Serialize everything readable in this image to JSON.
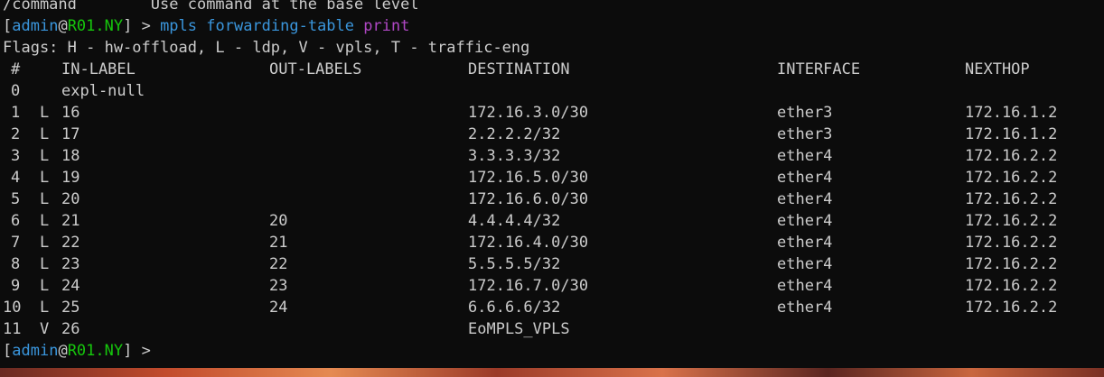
{
  "terminal": {
    "line0": {
      "cmd": "/command",
      "desc": "Use command at the base level"
    },
    "prompt1": {
      "open_bracket": "[",
      "user": "admin",
      "at": "@",
      "host": "R01.NY",
      "close": "] > ",
      "cmd1": "mpls",
      "cmd2": " forwarding-table",
      "cmd3": " print"
    },
    "flags_line": "Flags: H - hw-offload, L - ldp, V - vpls, T - traffic-eng",
    "headers": {
      "num": "#",
      "in_label": "IN-LABEL",
      "out_labels": "OUT-LABELS",
      "destination": "DESTINATION",
      "interface": "INTERFACE",
      "nexthop": "NEXTHOP"
    },
    "rows": [
      {
        "num": "0",
        "flag": "",
        "in": "expl-null",
        "out": "",
        "dst": "",
        "iface": "",
        "nh": ""
      },
      {
        "num": "1",
        "flag": "L",
        "in": "16",
        "out": "",
        "dst": "172.16.3.0/30",
        "iface": "ether3",
        "nh": "172.16.1.2"
      },
      {
        "num": "2",
        "flag": "L",
        "in": "17",
        "out": "",
        "dst": "2.2.2.2/32",
        "iface": "ether3",
        "nh": "172.16.1.2"
      },
      {
        "num": "3",
        "flag": "L",
        "in": "18",
        "out": "",
        "dst": "3.3.3.3/32",
        "iface": "ether4",
        "nh": "172.16.2.2"
      },
      {
        "num": "4",
        "flag": "L",
        "in": "19",
        "out": "",
        "dst": "172.16.5.0/30",
        "iface": "ether4",
        "nh": "172.16.2.2"
      },
      {
        "num": "5",
        "flag": "L",
        "in": "20",
        "out": "",
        "dst": "172.16.6.0/30",
        "iface": "ether4",
        "nh": "172.16.2.2"
      },
      {
        "num": "6",
        "flag": "L",
        "in": "21",
        "out": "20",
        "dst": "4.4.4.4/32",
        "iface": "ether4",
        "nh": "172.16.2.2"
      },
      {
        "num": "7",
        "flag": "L",
        "in": "22",
        "out": "21",
        "dst": "172.16.4.0/30",
        "iface": "ether4",
        "nh": "172.16.2.2"
      },
      {
        "num": "8",
        "flag": "L",
        "in": "23",
        "out": "22",
        "dst": "5.5.5.5/32",
        "iface": "ether4",
        "nh": "172.16.2.2"
      },
      {
        "num": "9",
        "flag": "L",
        "in": "24",
        "out": "23",
        "dst": "172.16.7.0/30",
        "iface": "ether4",
        "nh": "172.16.2.2"
      },
      {
        "num": "10",
        "flag": "L",
        "in": "25",
        "out": "24",
        "dst": "6.6.6.6/32",
        "iface": "ether4",
        "nh": "172.16.2.2"
      },
      {
        "num": "11",
        "flag": "V",
        "in": "26",
        "out": "",
        "dst": "EoMPLS_VPLS",
        "iface": "",
        "nh": ""
      }
    ],
    "prompt2": {
      "open_bracket": "[",
      "user": "admin",
      "at": "@",
      "host": "R01.NY",
      "close": "] > "
    }
  },
  "colors": {
    "background": "#0c0c0c",
    "text": "#cccccc",
    "user": "#3a96dd",
    "host": "#16c60c",
    "command": "#3a96dd",
    "argument": "#b148c6"
  }
}
